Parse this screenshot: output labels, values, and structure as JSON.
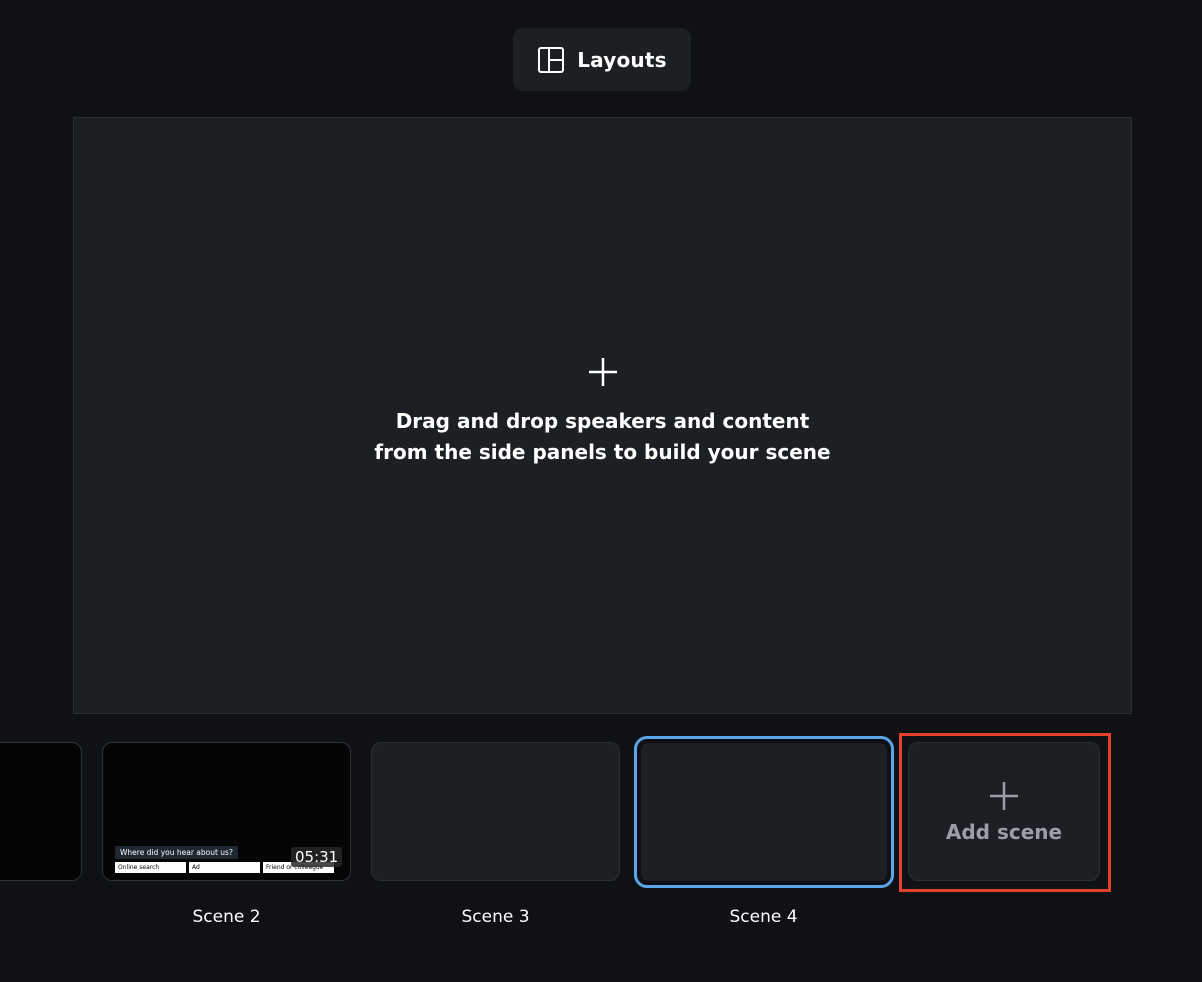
{
  "toolbar": {
    "layouts_label": "Layouts",
    "layouts_icon": "layout-grid-icon"
  },
  "canvas": {
    "plus_icon": "plus-icon",
    "hint": "Drag and drop speakers and content from the side panels to build your scene"
  },
  "scenes": [
    {
      "label": "Scene 2",
      "type": "video",
      "duration": "05:31",
      "poll_question": "Where did you hear about us?",
      "poll_options": [
        "Online search",
        "Ad",
        "Friend or colleague"
      ]
    },
    {
      "label": "Scene 3",
      "type": "empty"
    },
    {
      "label": "Scene 4",
      "type": "empty",
      "selected": true
    }
  ],
  "add_scene": {
    "label": "Add scene",
    "icon": "plus-icon"
  },
  "colors": {
    "background": "#0f1115",
    "panel": "#1c1f23",
    "selected_border": "#5aa6e6",
    "highlight_border": "#e4412c",
    "muted_text": "#9aa0a8"
  }
}
